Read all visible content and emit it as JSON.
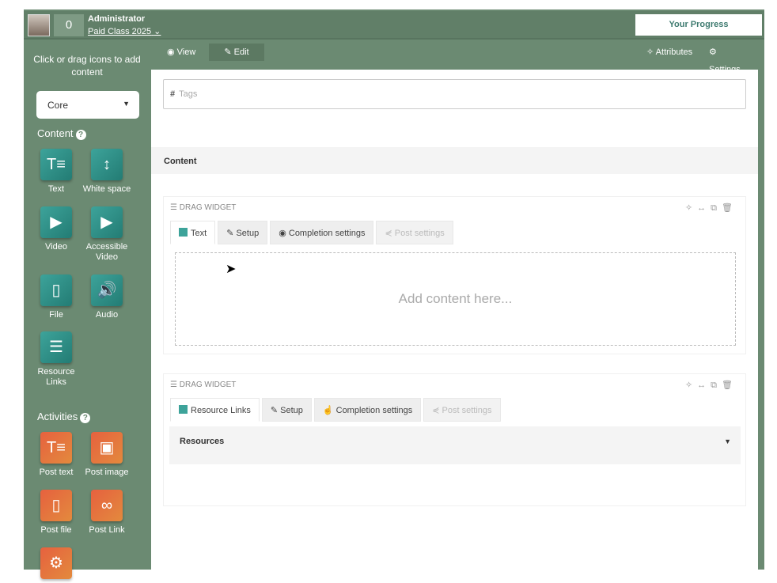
{
  "header": {
    "score": "0",
    "role": "Administrator",
    "class_name": "Paid Class 2025",
    "progress_button": "Your Progress"
  },
  "toolbar": {
    "view": "View",
    "edit": "Edit",
    "attributes": "Attributes",
    "settings": "Settings"
  },
  "sidebar": {
    "hint": "Click or drag icons to add content",
    "dropdown": "Core",
    "content_heading": "Content",
    "activities_heading": "Activities",
    "content_items": [
      {
        "label": "Text",
        "icon": "text-icon"
      },
      {
        "label": "White space",
        "icon": "white-space-icon"
      },
      {
        "label": "Video",
        "icon": "video-icon"
      },
      {
        "label": "Accessible Video",
        "icon": "video-icon"
      },
      {
        "label": "File",
        "icon": "file-icon"
      },
      {
        "label": "Audio",
        "icon": "audio-icon"
      },
      {
        "label": "Resource Links",
        "icon": "resource-links-icon"
      }
    ],
    "activity_items": [
      {
        "label": "Post text",
        "icon": "post-text-icon"
      },
      {
        "label": "Post image",
        "icon": "post-image-icon"
      },
      {
        "label": "Post file",
        "icon": "post-file-icon"
      },
      {
        "label": "Post Link",
        "icon": "post-link-icon"
      }
    ]
  },
  "main": {
    "tags_placeholder": "Tags",
    "content_label": "Content",
    "widgets": [
      {
        "handle": "DRAG WIDGET",
        "tabs": [
          "Text",
          "Setup",
          "Completion settings",
          "Post settings"
        ],
        "placeholder": "Add content here..."
      },
      {
        "handle": "DRAG WIDGET",
        "tabs": [
          "Resource Links",
          "Setup",
          "Completion settings",
          "Post settings"
        ],
        "section": "Resources"
      }
    ]
  },
  "colors": {
    "sidebar": "#6b8a72",
    "teal": "#2f928a",
    "orange": "#e6703e"
  }
}
